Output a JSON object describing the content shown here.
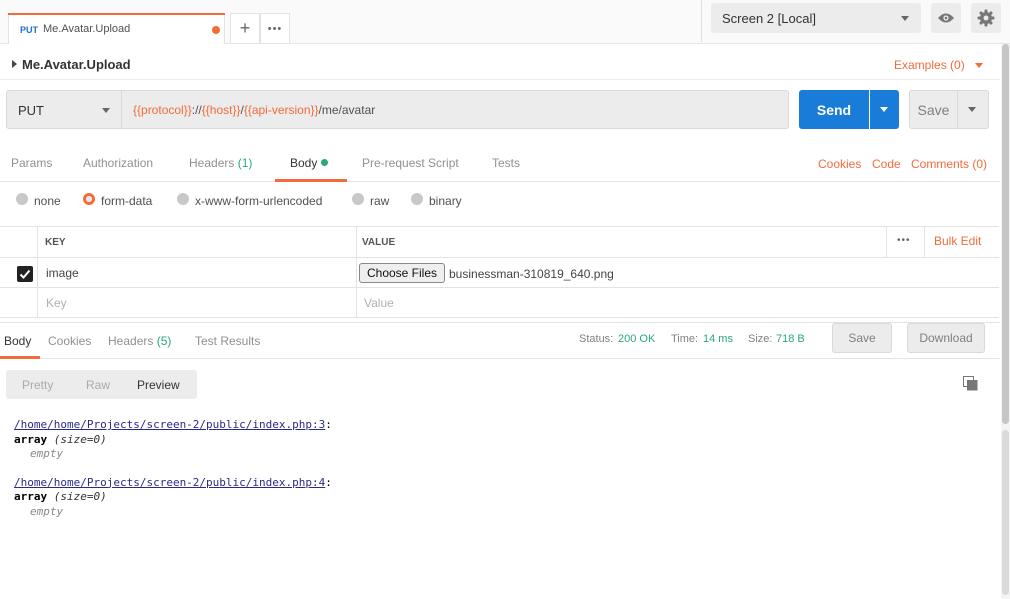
{
  "tab": {
    "method": "PUT",
    "name": "Me.Avatar.Upload"
  },
  "tab_buttons": {
    "new_tab": "+",
    "more": "•••"
  },
  "environment": {
    "selected": "Screen 2 [Local]"
  },
  "breadcrumb": {
    "title": "Me.Avatar.Upload",
    "examples": "Examples (0)"
  },
  "request": {
    "method": "PUT",
    "url_parts": [
      "{{protocol}}",
      "://",
      "{{host}}",
      "/",
      "{{api-version}}",
      "/me/avatar"
    ],
    "send_label": "Send",
    "save_label": "Save"
  },
  "request_tabs": [
    {
      "label": "Params"
    },
    {
      "label": "Authorization"
    },
    {
      "label": "Headers",
      "count": "(1)"
    },
    {
      "label": "Body"
    },
    {
      "label": "Pre-request Script"
    },
    {
      "label": "Tests"
    }
  ],
  "request_links": [
    "Cookies",
    "Code",
    "Comments (0)"
  ],
  "body_modes": [
    "none",
    "form-data",
    "x-www-form-urlencoded",
    "raw",
    "binary"
  ],
  "body_mode_selected": "form-data",
  "form_table": {
    "key_header": "KEY",
    "value_header": "VALUE",
    "more": "•••",
    "bulk_edit": "Bulk Edit",
    "row": {
      "key": "image",
      "file_button": "Choose Files",
      "file_name": "businessman-310819_640.png",
      "checked": true
    },
    "placeholder_key": "Key",
    "placeholder_value": "Value"
  },
  "response": {
    "tabs": [
      {
        "label": "Body"
      },
      {
        "label": "Cookies"
      },
      {
        "label": "Headers",
        "count": "(5)"
      },
      {
        "label": "Test Results"
      }
    ],
    "status_label": "Status:",
    "status_value": "200 OK",
    "time_label": "Time:",
    "time_value": "14 ms",
    "size_label": "Size:",
    "size_value": "718 B",
    "save_label": "Save",
    "download_label": "Download",
    "views": [
      "Pretty",
      "Raw",
      "Preview"
    ],
    "view_selected": "Preview",
    "output": [
      {
        "link": "/home/home/Projects/screen-2/public/index.php:3",
        "suffix": ":",
        "kw": "array",
        "size": "(size=0)",
        "empty": "empty"
      },
      {
        "link": "/home/home/Projects/screen-2/public/index.php:4",
        "suffix": ":",
        "kw": "array",
        "size": "(size=0)",
        "empty": "empty"
      }
    ]
  },
  "colors": {
    "accent": "#f26b3a",
    "primary": "#1a7cd9",
    "success": "#2aa876"
  }
}
